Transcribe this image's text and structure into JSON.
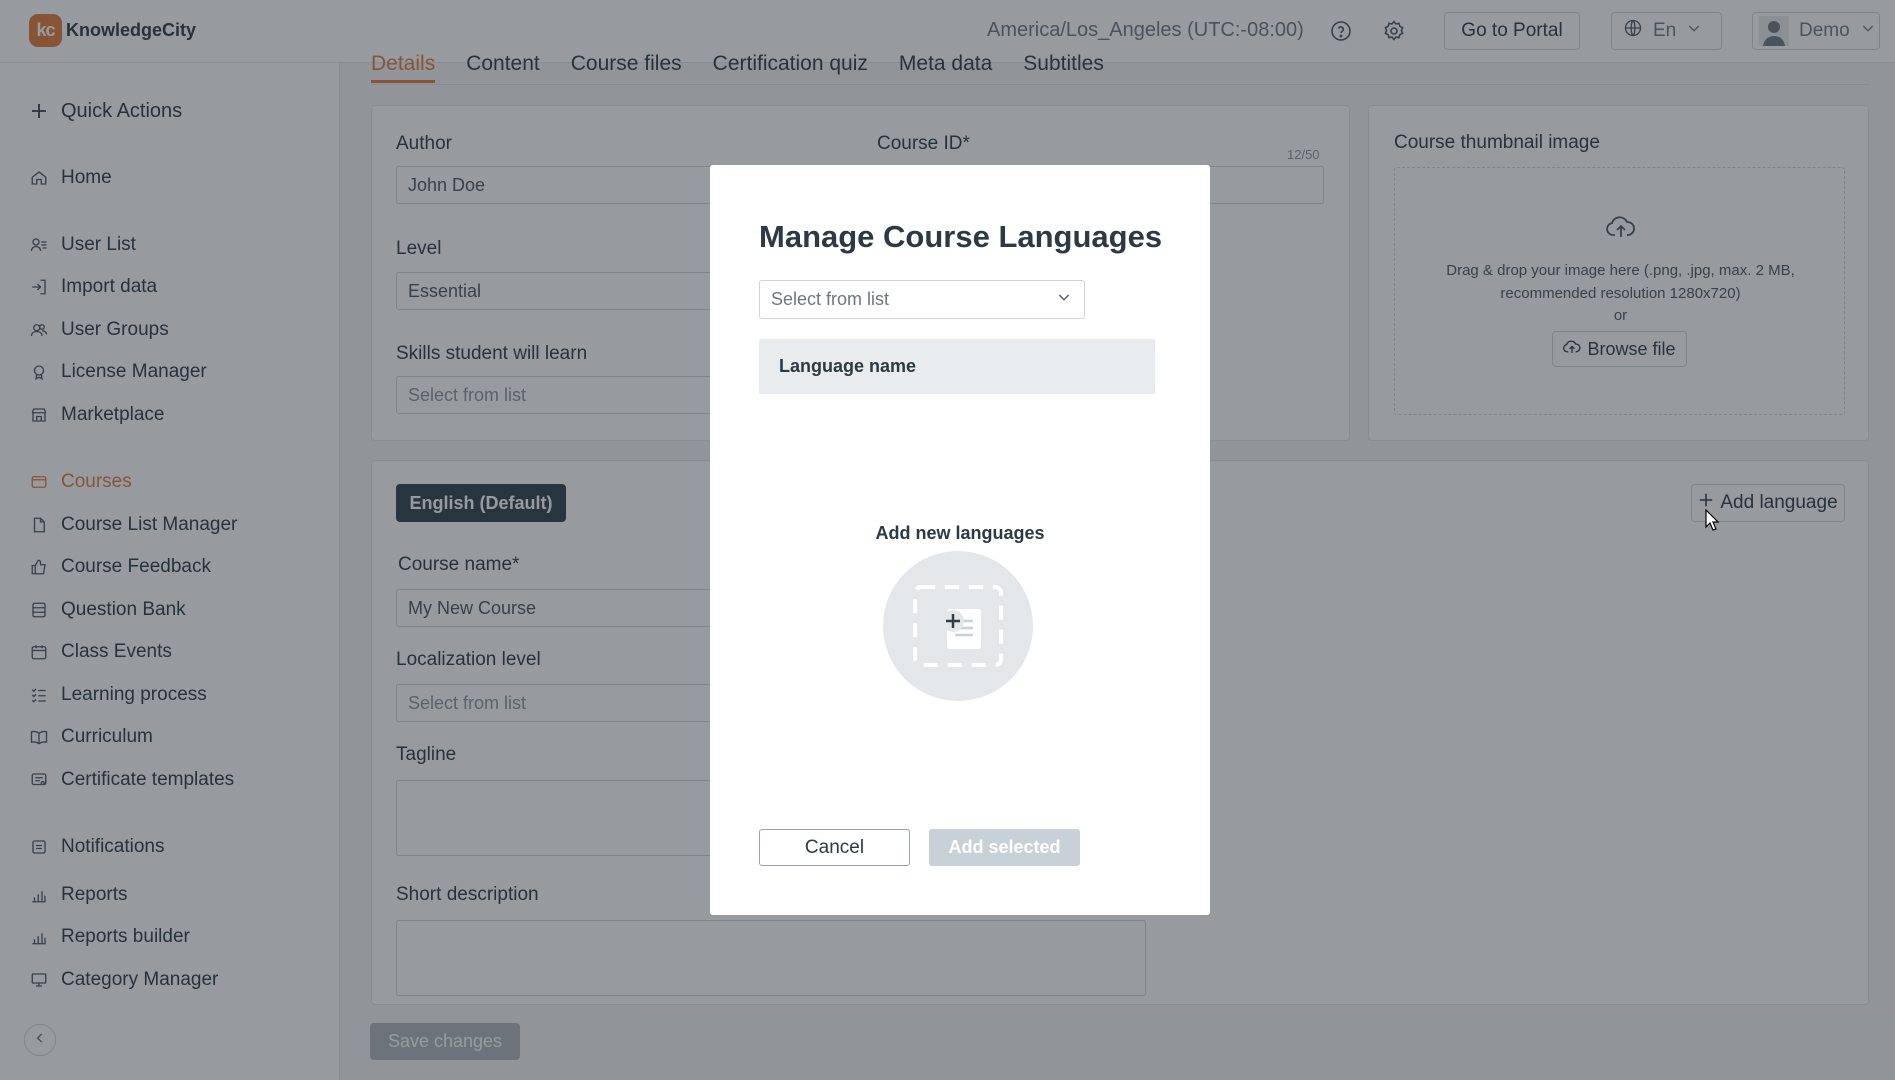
{
  "header": {
    "logo_mark": "kc",
    "logo_text": "KnowledgeCity",
    "timezone": "America/Los_Angeles (UTC:-08:00)",
    "go_to_portal": "Go to Portal",
    "language": "En",
    "user_name": "Demo",
    "icons": [
      "help-icon",
      "settings-icon",
      "globe-icon",
      "chevron-down-icon",
      "user-avatar-icon"
    ]
  },
  "sidebar": {
    "quick_actions": "Quick Actions",
    "items": [
      {
        "label": "Home",
        "icon": "home-icon"
      },
      {
        "label": "User List",
        "icon": "user-list-icon"
      },
      {
        "label": "Import data",
        "icon": "import-icon"
      },
      {
        "label": "User Groups",
        "icon": "user-groups-icon"
      },
      {
        "label": "License Manager",
        "icon": "license-icon"
      },
      {
        "label": "Marketplace",
        "icon": "marketplace-icon"
      },
      {
        "label": "Courses",
        "icon": "courses-icon",
        "active": true
      },
      {
        "label": "Course List Manager",
        "icon": "document-icon"
      },
      {
        "label": "Course Feedback",
        "icon": "thumbs-up-icon"
      },
      {
        "label": "Question Bank",
        "icon": "question-bank-icon"
      },
      {
        "label": "Class Events",
        "icon": "calendar-icon"
      },
      {
        "label": "Learning process",
        "icon": "checklist-icon"
      },
      {
        "label": "Curriculum",
        "icon": "book-icon"
      },
      {
        "label": "Certificate templates",
        "icon": "certificate-icon"
      },
      {
        "label": "Notifications",
        "icon": "notification-icon"
      },
      {
        "label": "Reports",
        "icon": "bar-chart-icon"
      },
      {
        "label": "Reports builder",
        "icon": "bar-chart-icon"
      },
      {
        "label": "Category Manager",
        "icon": "monitor-icon"
      }
    ]
  },
  "tabs": [
    "Details",
    "Content",
    "Course files",
    "Certification quiz",
    "Meta data",
    "Subtitles"
  ],
  "details": {
    "author_label": "Author",
    "author_value": "John Doe",
    "course_id_label": "Course ID*",
    "course_id_counter": "12/50",
    "level_label": "Level",
    "level_value": "Essential",
    "skills_label": "Skills student will learn",
    "skills_placeholder": "Select from list"
  },
  "thumbnail": {
    "title": "Course thumbnail image",
    "drop_line1": "Drag & drop your image here (.png, .jpg, max. 2 MB,",
    "drop_line2": "recommended resolution 1280x720)",
    "or": "or",
    "browse": "Browse file"
  },
  "languages": {
    "default_pill": "English (Default)",
    "add_language": "Add language",
    "course_name_label": "Course name*",
    "course_name_value": "My New Course",
    "localization_label": "Localization level",
    "localization_placeholder": "Select from list",
    "tagline_label": "Tagline",
    "short_desc_label": "Short description"
  },
  "save_changes": "Save changes",
  "modal": {
    "title": "Manage Course Languages",
    "select_placeholder": "Select from list",
    "column_header": "Language name",
    "empty_label": "Add new languages",
    "cancel": "Cancel",
    "add_selected": "Add selected"
  },
  "colors": {
    "accent": "#e07a3a",
    "dark_pill": "#2f3e48",
    "overlay": "rgba(33,43,51,0.47)"
  }
}
